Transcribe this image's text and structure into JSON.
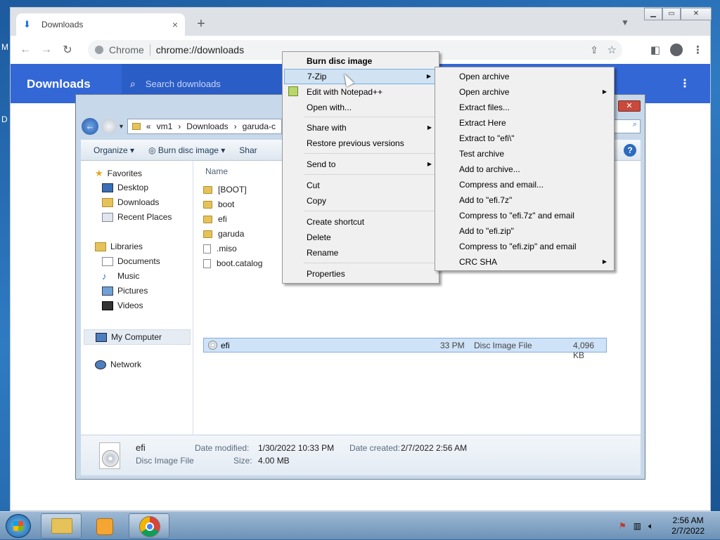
{
  "desktop": {
    "left_letters": [
      "M",
      "D"
    ]
  },
  "chrome": {
    "tab": {
      "icon": "download-icon",
      "title": "Downloads",
      "close": "×"
    },
    "new_tab": "+",
    "omnibox": {
      "site": "Chrome",
      "url": "chrome://downloads"
    },
    "page": {
      "title": "Downloads",
      "search_placeholder": "Search downloads"
    }
  },
  "explorer": {
    "breadcrumb": [
      "«",
      "vm1",
      "›",
      "Downloads",
      "›",
      "garuda-c"
    ],
    "toolbar": [
      "Organize",
      "Burn disc image",
      "Shar"
    ],
    "nav": {
      "favorites": "Favorites",
      "fav_items": [
        "Desktop",
        "Downloads",
        "Recent Places"
      ],
      "libraries": "Libraries",
      "lib_items": [
        "Documents",
        "Music",
        "Pictures",
        "Videos"
      ],
      "computer": "My Computer",
      "network": "Network"
    },
    "column": "Name",
    "files": [
      "[BOOT]",
      "boot",
      "efi",
      "garuda",
      ".miso",
      "boot.catalog"
    ],
    "selected": {
      "name": "efi",
      "time": "33 PM",
      "type": "Disc Image File",
      "size": "4,096 KB"
    },
    "details": {
      "name": "efi",
      "type": "Disc Image File",
      "modified_label": "Date modified:",
      "modified": "1/30/2022 10:33 PM",
      "size_label": "Size:",
      "size": "4.00 MB",
      "created_label": "Date created:",
      "created": "2/7/2022 2:56 AM"
    }
  },
  "context_menu": {
    "items": [
      "Burn disc image",
      "7-Zip",
      "Edit with Notepad++",
      "Open with...",
      "Share with",
      "Restore previous versions",
      "Send to",
      "Cut",
      "Copy",
      "Create shortcut",
      "Delete",
      "Rename",
      "Properties"
    ]
  },
  "submenu": {
    "items": [
      "Open archive",
      "Open archive",
      "Extract files...",
      "Extract Here",
      "Extract to \"efi\\\"",
      "Test archive",
      "Add to archive...",
      "Compress and email...",
      "Add to \"efi.7z\"",
      "Compress to \"efi.7z\" and email",
      "Add to \"efi.zip\"",
      "Compress to \"efi.zip\" and email",
      "CRC SHA"
    ]
  },
  "taskbar": {
    "time": "2:56 AM",
    "date": "2/7/2022"
  }
}
